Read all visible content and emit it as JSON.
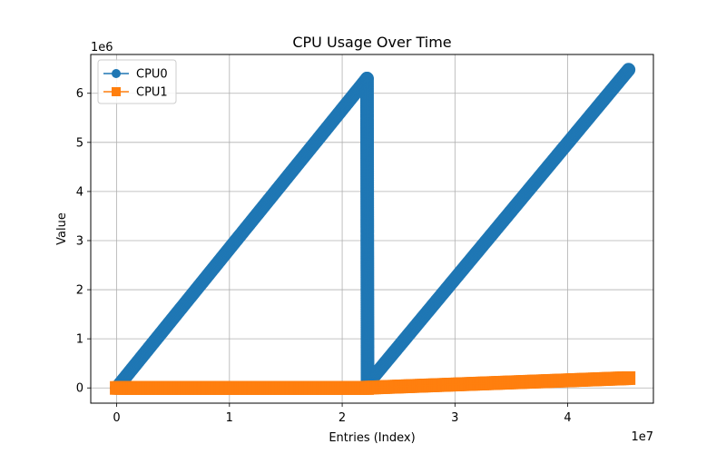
{
  "chart_data": {
    "type": "line",
    "title": "CPU Usage Over Time",
    "xlabel": "Entries (Index)",
    "ylabel": "Value",
    "x_offset_label": "1e7",
    "y_offset_label": "1e6",
    "xlim": [
      -2300000,
      47600000
    ],
    "ylim": [
      -310000,
      6790000
    ],
    "xticks": [
      0,
      10000000,
      20000000,
      30000000,
      40000000
    ],
    "xtick_labels": [
      "0",
      "1",
      "2",
      "3",
      "4"
    ],
    "yticks": [
      0,
      1000000,
      2000000,
      3000000,
      4000000,
      5000000,
      6000000
    ],
    "ytick_labels": [
      "0",
      "1",
      "2",
      "3",
      "4",
      "5",
      "6"
    ],
    "grid": true,
    "legend": "upper-left",
    "series": [
      {
        "name": "CPU0",
        "color": "#1f77b4",
        "marker": "circle",
        "x": [
          0,
          22200000,
          22200000,
          22250000,
          45400000
        ],
        "y": [
          0,
          6300000,
          6300000,
          80000,
          6480000
        ]
      },
      {
        "name": "CPU1",
        "color": "#ff7f0e",
        "marker": "square",
        "x": [
          0,
          22200000,
          22250000,
          45400000
        ],
        "y": [
          0,
          0,
          5000,
          200000
        ]
      }
    ]
  }
}
